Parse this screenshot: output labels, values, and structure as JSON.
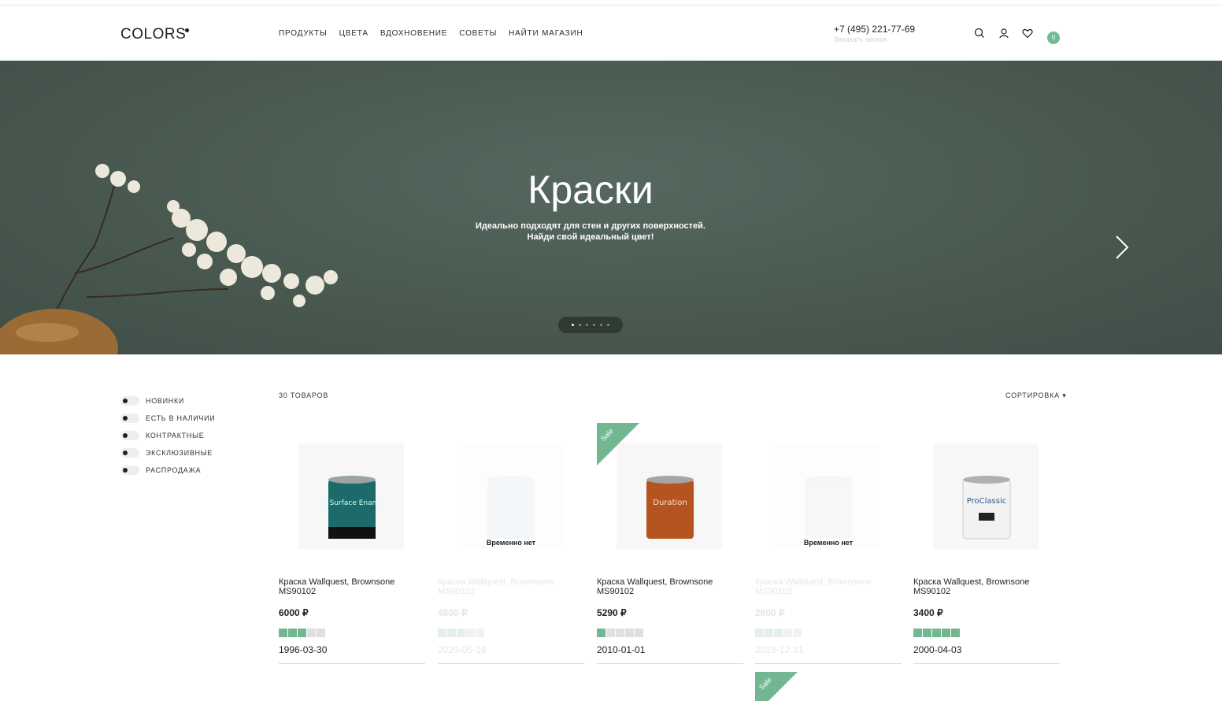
{
  "header": {
    "logo": "COLORS",
    "nav": [
      "ПРОДУКТЫ",
      "ЦВЕТА",
      "ВДОХНОВЕНИЕ",
      "СОВЕТЫ",
      "НАЙТИ МАГАЗИН"
    ],
    "phone": "+7 (495) 221-77-69",
    "callback": "Заказать звонок",
    "cart_count": "0",
    "icons": [
      "search-icon",
      "user-icon",
      "heart-icon",
      "cart-icon"
    ]
  },
  "hero": {
    "title": "Краски",
    "subtitle_line1": "Идеально подходят для стен и других поверхностей.",
    "subtitle_line2": "Найди свой идеальный цвет!",
    "slide_count": 6,
    "active_slide": 1
  },
  "filters": [
    "НОВИНКИ",
    "ЕСТЬ В НАЛИЧИИ",
    "КОНТРАКТНЫЕ",
    "ЭКСКЛЮЗИВНЫЕ",
    "РАСПРОДАЖА"
  ],
  "catalog": {
    "count": "30 ТОВАРОВ",
    "sort": "СОРТИРОВКА ▾",
    "products": [
      {
        "name": "Краска Wallquest, Brownsone MS90102",
        "price": "6000 ₽",
        "rating": 3,
        "date": "1996-03-30",
        "available": true,
        "sale": false,
        "label": "All Surface Enamel"
      },
      {
        "name": "Краска Wallquest, Brownsone MS90102",
        "price": "4800 ₽",
        "rating": 3,
        "date": "2020-05-19",
        "available": false,
        "sale": false,
        "status": "Временно нет"
      },
      {
        "name": "Краска Wallquest, Brownsone MS90102",
        "price": "5290 ₽",
        "rating": 1,
        "date": "2010-01-01",
        "available": true,
        "sale": true,
        "sale_label": "Sale",
        "label": "Duration"
      },
      {
        "name": "Краска Wallquest, Brownsone MS90102",
        "price": "2800 ₽",
        "rating": 3,
        "date": "2018-12-31",
        "available": false,
        "sale": false,
        "status": "Временно нет"
      },
      {
        "name": "Краска Wallquest, Brownsone MS90102",
        "price": "3400 ₽",
        "rating": 5,
        "date": "2000-04-03",
        "available": true,
        "sale": false,
        "label": "ProClassic"
      }
    ],
    "next_row_sale_label": "Sale"
  },
  "colors": {
    "accent": "#73b692",
    "hero_bg": "#4c5e56"
  }
}
